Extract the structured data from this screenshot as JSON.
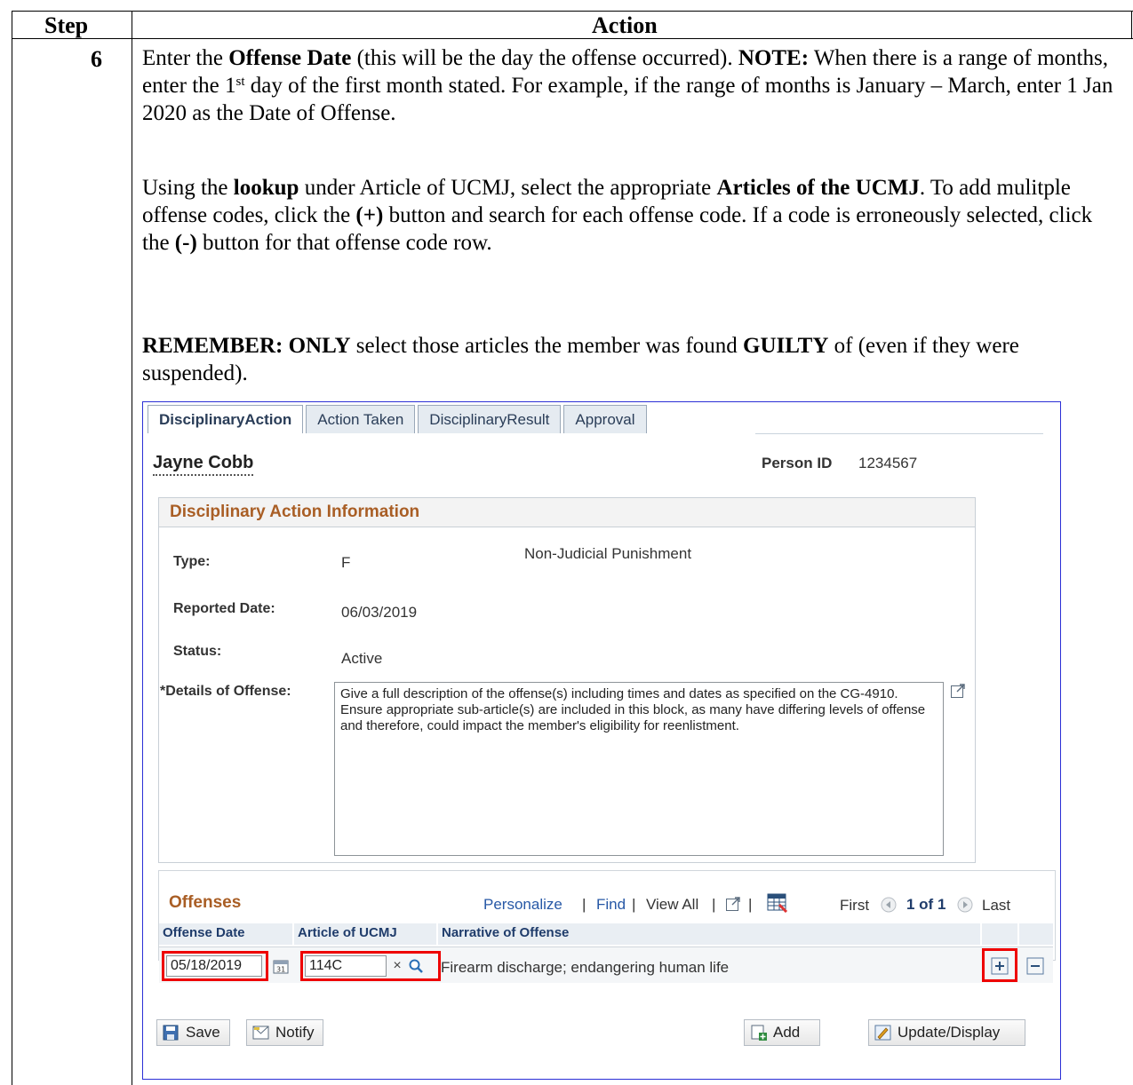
{
  "table": {
    "header_step": "Step",
    "header_action": "Action",
    "step_number": "6"
  },
  "instructions": {
    "p1_a": "Enter the ",
    "p1_b": "Offense Date",
    "p1_c": " (this will be the day the offense occurred).  ",
    "p1_d": "NOTE:",
    "p1_e": "  When there is a range of months, enter the 1",
    "p1_sup": "st",
    "p1_f": " day of the first month stated.  For example, if the range of months is January – March, enter 1 Jan 2020 as the Date of Offense.",
    "p2_a": "Using the ",
    "p2_b": "lookup",
    "p2_c": " under Article of UCMJ, select the appropriate ",
    "p2_d": "Articles of the UCMJ",
    "p2_e": ".  To add mulitple offense codes, click the ",
    "p2_f": "(+)",
    "p2_g": " button and search for each offense code.  If a code is erroneously selected, click the ",
    "p2_h": "(-)",
    "p2_i": " button for that offense code row.",
    "p3_a": "REMEMBER:  ONLY",
    "p3_b": " select those articles the member was found ",
    "p3_c": "GUILTY",
    "p3_d": " of (even if they were suspended)."
  },
  "app": {
    "tabs": [
      "DisciplinaryAction",
      "Action Taken",
      "DisciplinaryResult",
      "Approval"
    ],
    "employee_name": "Jayne Cobb",
    "person_id_label": "Person ID",
    "person_id": "1234567",
    "group_title": "Disciplinary Action Information",
    "type_label": "Type:",
    "type_code": "F",
    "type_desc": "Non-Judicial Punishment",
    "reported_label": "Reported Date:",
    "reported_date": "06/03/2019",
    "status_label": "Status:",
    "status_value": "Active",
    "details_label": "*Details of Offense:",
    "details_text": "Give a full description of the offense(s) including times and dates as specified on the CG-4910.  Ensure appropriate sub-article(s) are included in this block, as many have differing levels of offense and therefore, could impact the member's eligibility for reenlistment.",
    "offenses": {
      "title": "Offenses",
      "personalize": "Personalize",
      "find": "Find",
      "view_all": "View All",
      "first": "First",
      "count": "1 of 1",
      "last": "Last",
      "col_date": "Offense Date",
      "col_article": "Article of UCMJ",
      "col_narrative": "Narrative of Offense",
      "row": {
        "date": "05/18/2019",
        "article": "114C",
        "narrative": "Firearm discharge; endangering human life"
      }
    },
    "buttons": {
      "save": "Save",
      "notify": "Notify",
      "add": "Add",
      "update": "Update/Display"
    }
  },
  "colors": {
    "highlight": "#ee0000",
    "section_title": "#a95e25",
    "link": "#2758a6",
    "frame": "#2b2fd6"
  }
}
